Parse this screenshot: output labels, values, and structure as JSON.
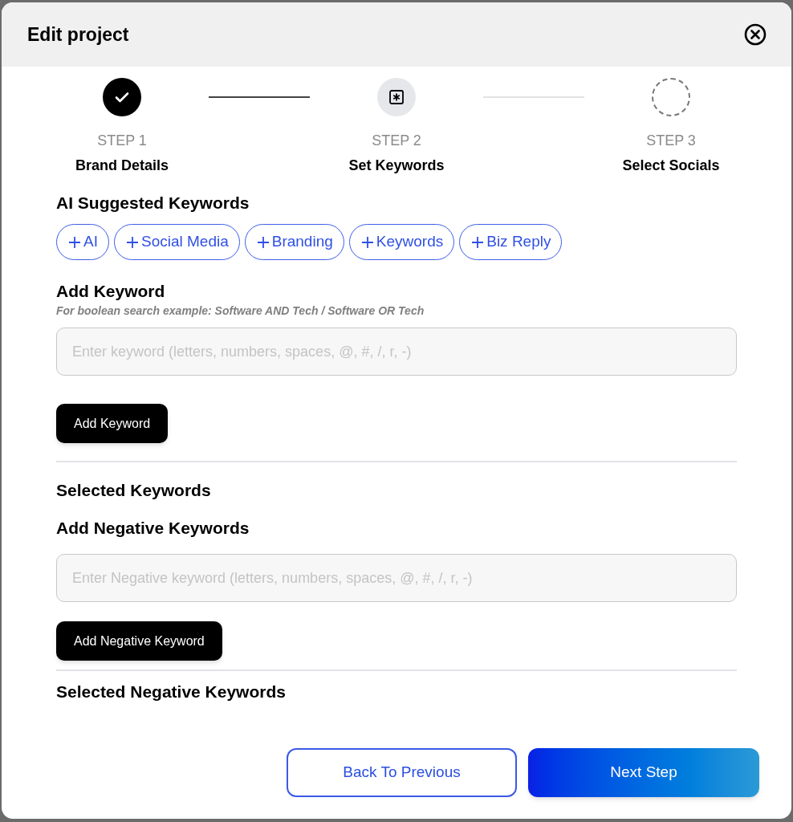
{
  "dialog": {
    "title": "Edit project"
  },
  "steps": [
    {
      "label": "STEP 1",
      "name": "Brand Details",
      "kind": "done"
    },
    {
      "label": "STEP 2",
      "name": "Set Keywords",
      "kind": "current"
    },
    {
      "label": "STEP 3",
      "name": "Select Socials",
      "kind": "pending"
    }
  ],
  "suggested": {
    "heading": "AI Suggested Keywords",
    "chips": [
      "AI",
      "Social Media",
      "Branding",
      "Keywords",
      "Biz Reply"
    ]
  },
  "keyword": {
    "heading": "Add Keyword",
    "hint": "For boolean search example: Software AND Tech / Software OR Tech",
    "placeholder": "Enter keyword (letters, numbers, spaces, @, #, /, r, -)",
    "button": "Add Keyword",
    "selected_heading": "Selected Keywords"
  },
  "negative": {
    "heading": "Add Negative Keywords",
    "placeholder": "Enter Negative keyword (letters, numbers, spaces, @, #, /, r, -)",
    "button": "Add Negative Keyword",
    "selected_heading": "Selected Negative Keywords"
  },
  "footer": {
    "back": "Back To Previous",
    "next": "Next Step"
  }
}
